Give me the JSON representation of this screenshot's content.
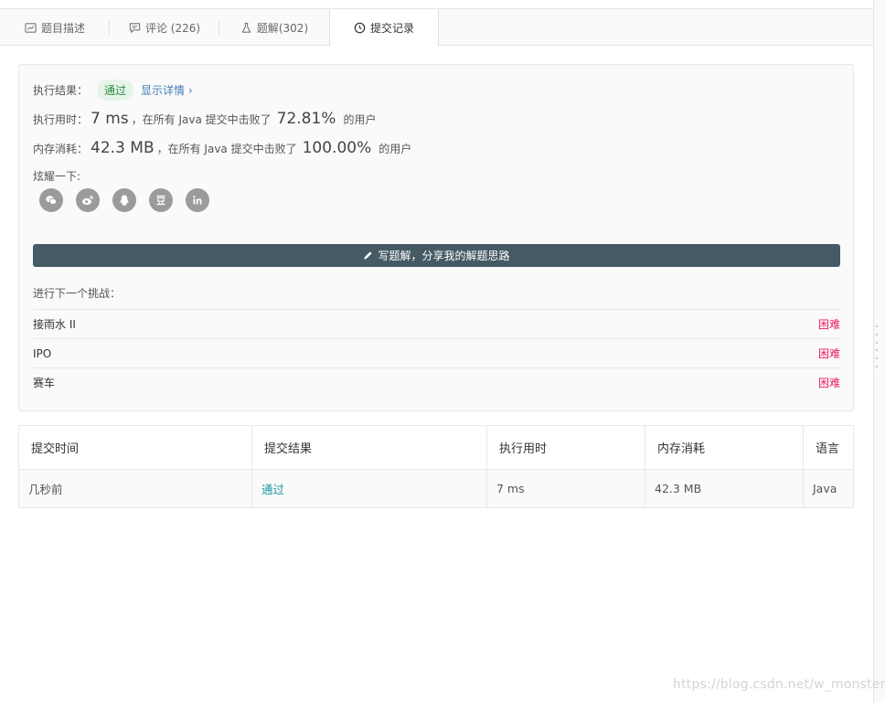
{
  "tabs": [
    {
      "label": "题目描述",
      "icon": "description-icon"
    },
    {
      "label": "评论 (226)",
      "icon": "comment-icon"
    },
    {
      "label": "题解(302)",
      "icon": "flask-icon"
    },
    {
      "label": "提交记录",
      "icon": "clock-icon",
      "active": true
    }
  ],
  "result": {
    "label": "执行结果：",
    "status": "通过",
    "details_link": "显示详情 ›"
  },
  "runtime": {
    "label": "执行用时：",
    "value": "7 ms",
    "middle": "，在所有 Java 提交中击败了",
    "percent": "72.81%",
    "suffix": "的用户"
  },
  "memory": {
    "label": "内存消耗：",
    "value": "42.3 MB",
    "middle": "，在所有 Java 提交中击败了",
    "percent": "100.00%",
    "suffix": "的用户"
  },
  "share": {
    "label": "炫耀一下:",
    "icons": [
      "wechat-icon",
      "weibo-icon",
      "qq-icon",
      "douban-icon",
      "linkedin-icon"
    ]
  },
  "write_solution": {
    "label": "写题解，分享我的解题思路"
  },
  "next_challenge": {
    "title": "进行下一个挑战：",
    "items": [
      {
        "name": "接雨水 II",
        "difficulty": "困难"
      },
      {
        "name": "IPO",
        "difficulty": "困难"
      },
      {
        "name": "赛车",
        "difficulty": "困难"
      }
    ]
  },
  "submissions": {
    "headers": [
      "提交时间",
      "提交结果",
      "执行用时",
      "内存消耗",
      "语言"
    ],
    "rows": [
      {
        "time": "几秒前",
        "status": "通过",
        "runtime": "7 ms",
        "memory": "42.3 MB",
        "language": "Java"
      }
    ]
  },
  "watermark": "https://blog.csdn.net/w_monster",
  "colors": {
    "accent_pass": "#2a8c3c",
    "link": "#447cb5",
    "hard": "#e91e63",
    "button_bg": "#455a64"
  }
}
